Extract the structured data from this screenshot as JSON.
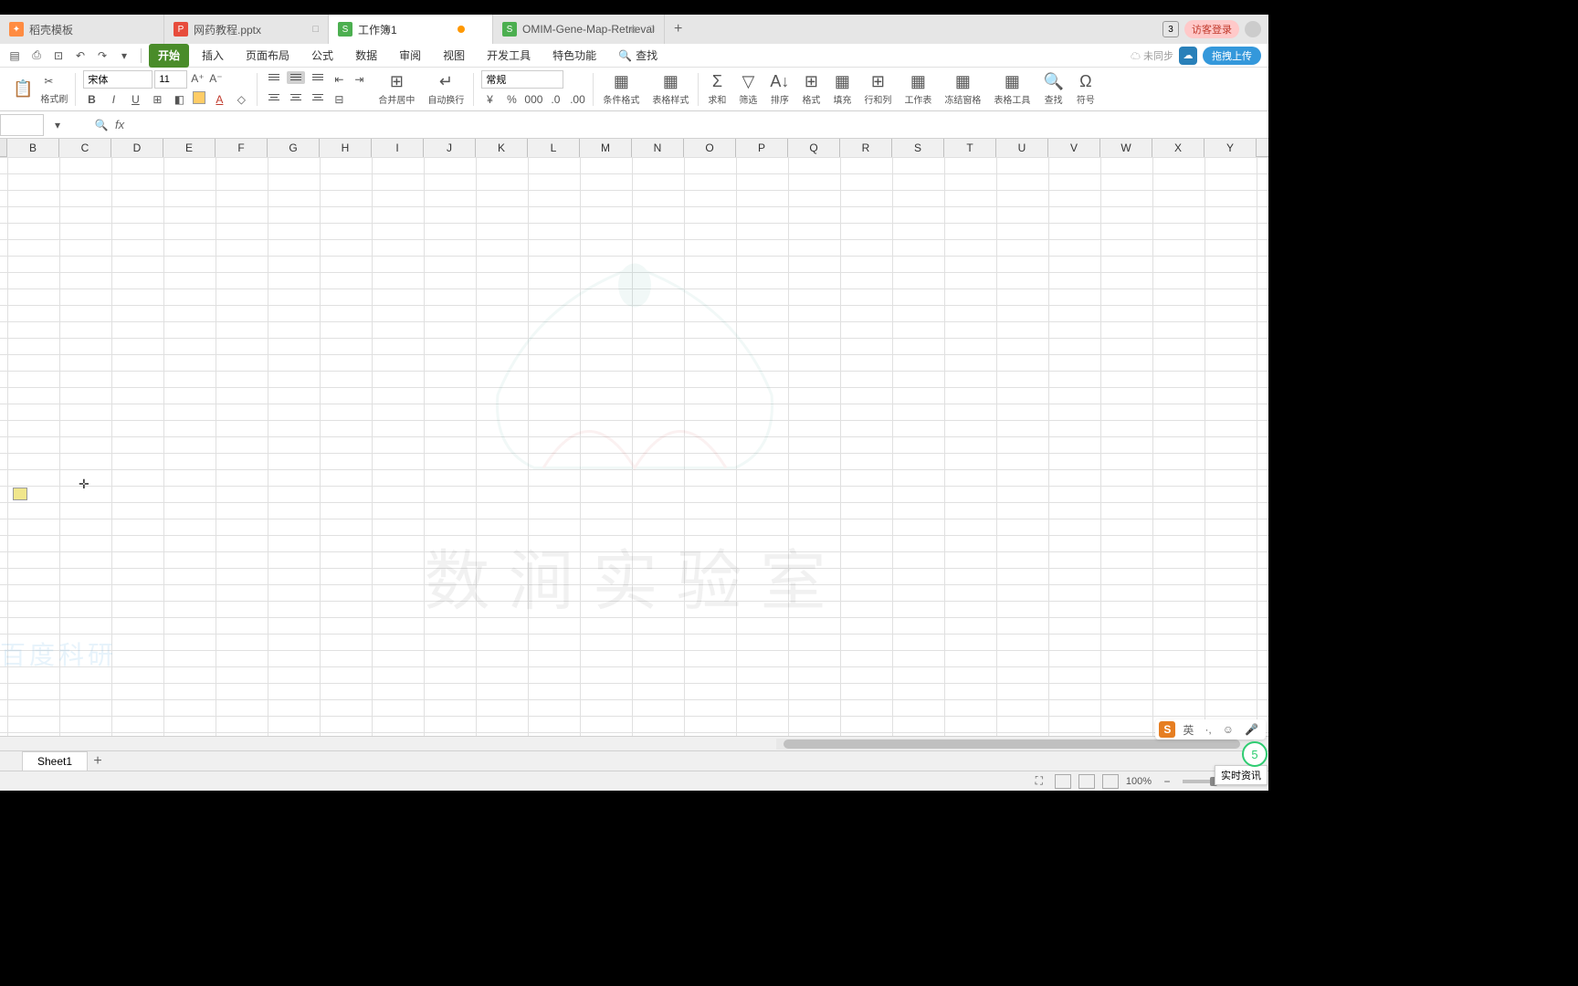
{
  "tabs": [
    {
      "icon": "orange",
      "label": "稻壳模板"
    },
    {
      "icon": "red",
      "label": "网药教程.pptx"
    },
    {
      "icon": "green",
      "label": "工作簿1",
      "active": true,
      "modified": true
    },
    {
      "icon": "green",
      "label": "OMIM-Gene-Map-Retrieval"
    }
  ],
  "topRight": {
    "badgeCount": "3",
    "guestLogin": "访客登录"
  },
  "menu": {
    "items": [
      "开始",
      "插入",
      "页面布局",
      "公式",
      "数据",
      "审阅",
      "视图",
      "开发工具",
      "特色功能"
    ],
    "active": "开始",
    "search": "查找",
    "unsynced": "未同步",
    "cloudUpload": "拖拽上传"
  },
  "ribbon": {
    "formatPainter": "格式刷",
    "fontName": "宋体",
    "fontSize": "11",
    "mergeCenter": "合并居中",
    "autoWrap": "自动换行",
    "numberFormat": "常规",
    "conditionalFormat": "条件格式",
    "tableStyle": "表格样式",
    "sum": "求和",
    "filter": "筛选",
    "sort": "排序",
    "format": "格式",
    "fill": "填充",
    "rowCol": "行和列",
    "worksheet": "工作表",
    "freeze": "冻结窗格",
    "tableTools": "表格工具",
    "find": "查找",
    "symbol": "符号"
  },
  "nameBox": "",
  "columns": [
    "B",
    "C",
    "D",
    "E",
    "F",
    "G",
    "H",
    "I",
    "J",
    "K",
    "L",
    "M",
    "N",
    "O",
    "P",
    "Q",
    "R",
    "S",
    "T",
    "U",
    "V",
    "W",
    "X",
    "Y"
  ],
  "watermarkText": "数涧实验室",
  "watermark2": "百度科研",
  "sheetTab": "Sheet1",
  "zoom": "100%",
  "realtimeInfo": "实时资讯",
  "ime": {
    "lang": "英",
    "badge": "5"
  }
}
